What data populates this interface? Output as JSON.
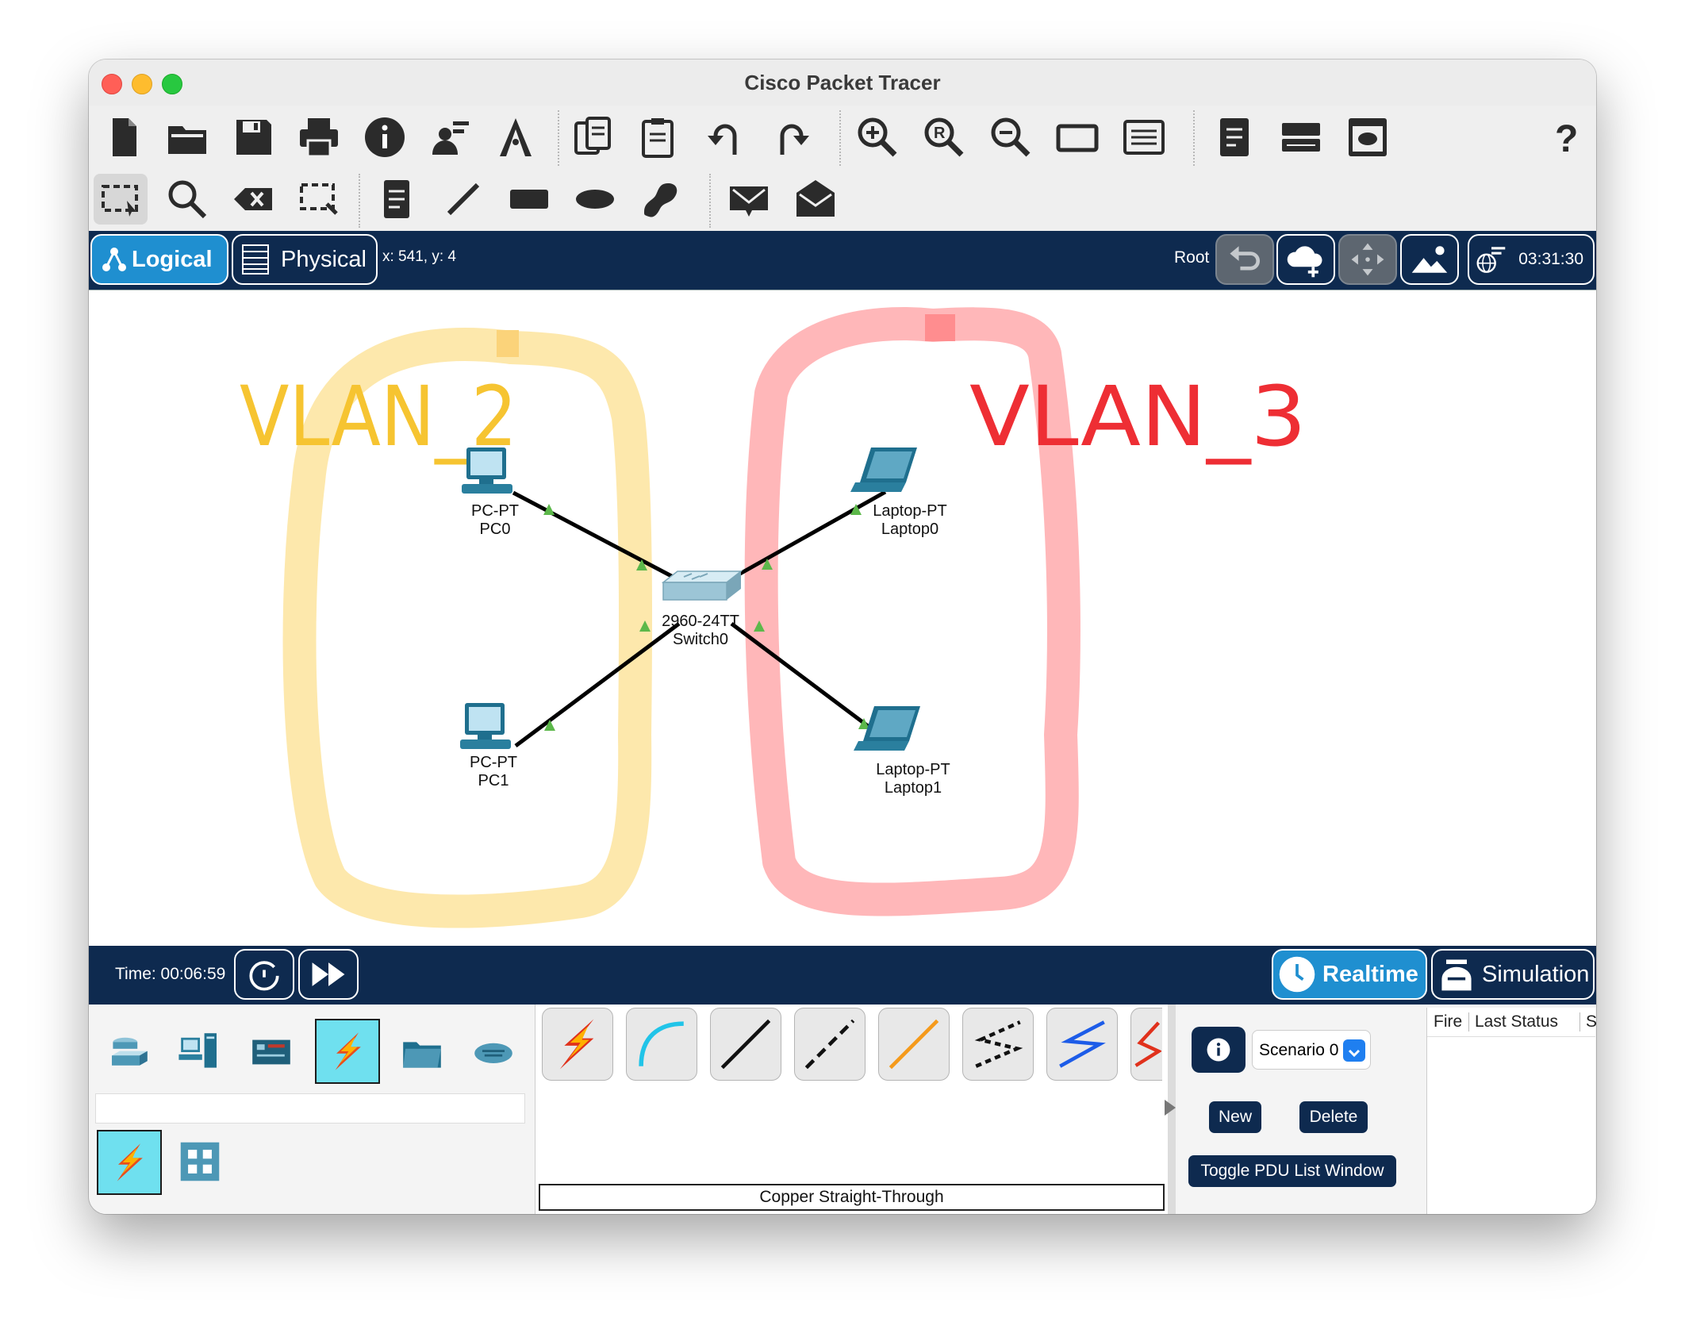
{
  "window": {
    "title": "Cisco Packet Tracer"
  },
  "workspace": {
    "logical_label": "Logical",
    "physical_label": "Physical",
    "coords": "x: 541, y: 4",
    "root_label": "Root",
    "clock": "03:31:30"
  },
  "topology": {
    "annotations": {
      "vlan2": "VLAN_2",
      "vlan3": "VLAN_3"
    },
    "devices": [
      {
        "type": "PC-PT",
        "name": "PC0"
      },
      {
        "type": "PC-PT",
        "name": "PC1"
      },
      {
        "type": "2960-24TT",
        "name": "Switch0"
      },
      {
        "type": "Laptop-PT",
        "name": "Laptop0"
      },
      {
        "type": "Laptop-PT",
        "name": "Laptop1"
      }
    ],
    "colors": {
      "vlan2": "#fde7a8",
      "vlan3": "#ffb3b5",
      "link_up": "#5cb84a"
    }
  },
  "timebar": {
    "time": "Time: 00:06:59",
    "realtime_label": "Realtime",
    "simulation_label": "Simulation"
  },
  "cables": {
    "selected_label": "Copper Straight-Through"
  },
  "pdu": {
    "scenario": "Scenario 0",
    "new_label": "New",
    "delete_label": "Delete",
    "toggle_label": "Toggle PDU List Window",
    "columns": [
      "Fire",
      "Last Status",
      "S"
    ]
  }
}
